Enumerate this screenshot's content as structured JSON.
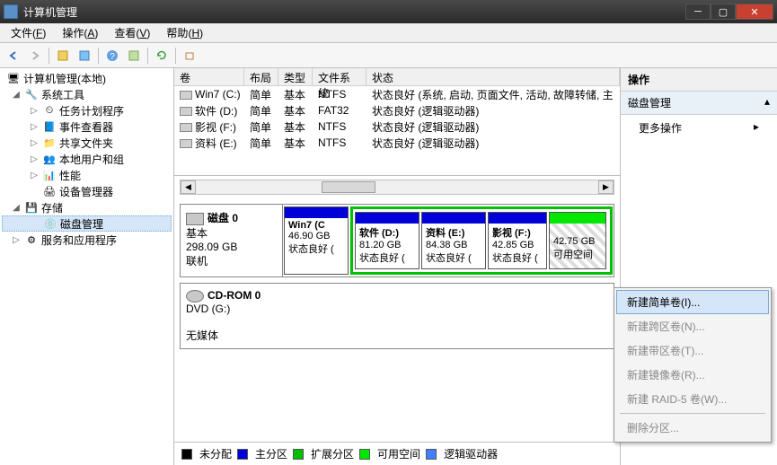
{
  "titlebar": {
    "title": "计算机管理"
  },
  "menubar": [
    {
      "label": "文件",
      "key": "F"
    },
    {
      "label": "操作",
      "key": "A"
    },
    {
      "label": "查看",
      "key": "V"
    },
    {
      "label": "帮助",
      "key": "H"
    }
  ],
  "tree": {
    "root": "计算机管理(本地)",
    "sys_tools": "系统工具",
    "task_sched": "任务计划程序",
    "event_viewer": "事件查看器",
    "shared": "共享文件夹",
    "users": "本地用户和组",
    "perf": "性能",
    "devmgr": "设备管理器",
    "storage": "存储",
    "diskmgmt": "磁盘管理",
    "services": "服务和应用程序"
  },
  "vol_headers": {
    "vol": "卷",
    "layout": "布局",
    "type": "类型",
    "fs": "文件系统",
    "status": "状态"
  },
  "volumes": [
    {
      "name": "Win7 (C:)",
      "layout": "简单",
      "type": "基本",
      "fs": "NTFS",
      "status": "状态良好 (系统, 启动, 页面文件, 活动, 故障转储, 主"
    },
    {
      "name": "软件 (D:)",
      "layout": "简单",
      "type": "基本",
      "fs": "FAT32",
      "status": "状态良好 (逻辑驱动器)"
    },
    {
      "name": "影视 (F:)",
      "layout": "简单",
      "type": "基本",
      "fs": "NTFS",
      "status": "状态良好 (逻辑驱动器)"
    },
    {
      "name": "资料 (E:)",
      "layout": "简单",
      "type": "基本",
      "fs": "NTFS",
      "status": "状态良好 (逻辑驱动器)"
    }
  ],
  "disk0": {
    "name": "磁盘 0",
    "type": "基本",
    "size": "298.09 GB",
    "status": "联机",
    "parts": [
      {
        "name": "Win7  (C",
        "size": "46.90 GB",
        "status": "状态良好 ("
      },
      {
        "name": "软件   (D:)",
        "size": "81.20 GB",
        "status": "状态良好 ("
      },
      {
        "name": "资料   (E:)",
        "size": "84.38 GB",
        "status": "状态良好 ("
      },
      {
        "name": "影视   (F:)",
        "size": "42.85 GB",
        "status": "状态良好 ("
      },
      {
        "name": "",
        "size": "42.75 GB",
        "status": "可用空间"
      }
    ]
  },
  "cdrom": {
    "name": "CD-ROM 0",
    "drive": "DVD (G:)",
    "status": "无媒体"
  },
  "legend": {
    "unalloc": "未分配",
    "primary": "主分区",
    "extended": "扩展分区",
    "free": "可用空间",
    "logical": "逻辑驱动器"
  },
  "actions": {
    "header": "操作",
    "sub": "磁盘管理",
    "more": "更多操作"
  },
  "context": {
    "new_simple": "新建简单卷(I)...",
    "new_span": "新建跨区卷(N)...",
    "new_stripe": "新建带区卷(T)...",
    "new_mirror": "新建镜像卷(R)...",
    "new_raid5": "新建 RAID-5 卷(W)...",
    "delete": "删除分区..."
  }
}
